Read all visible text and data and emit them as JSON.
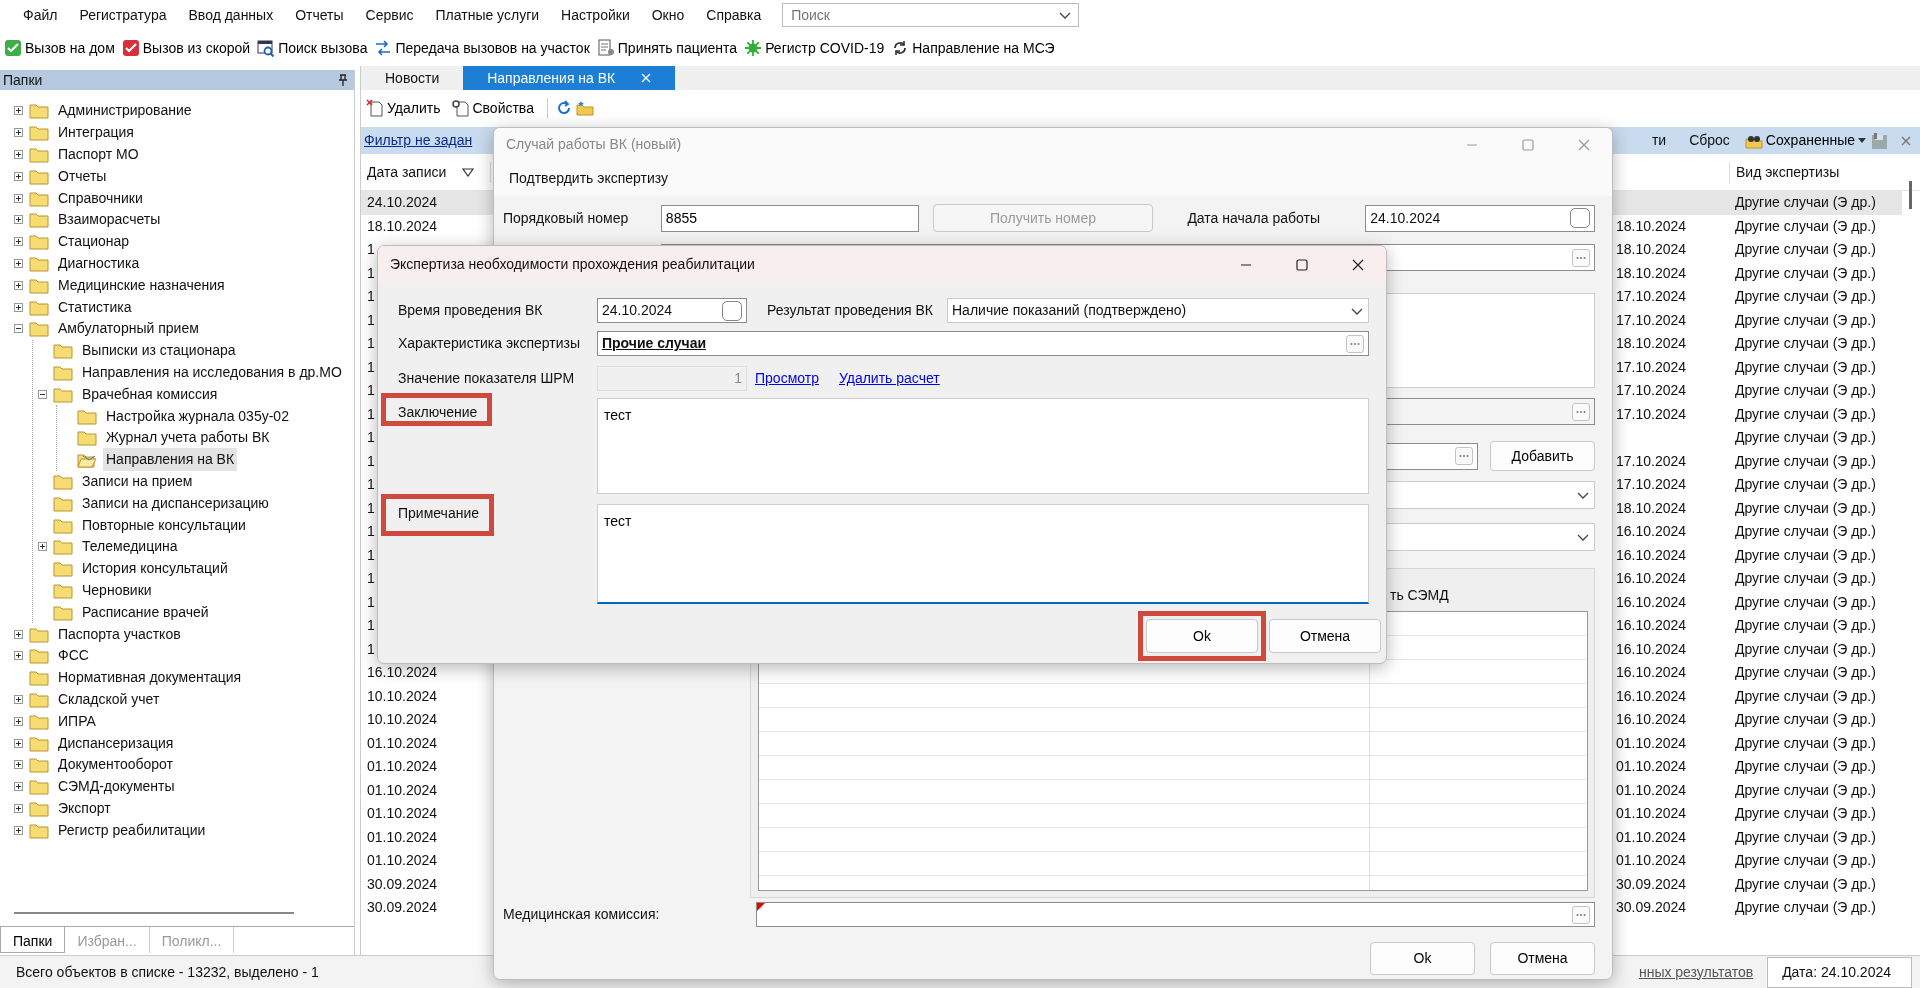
{
  "menu": [
    "Файл",
    "Регистратура",
    "Ввод данных",
    "Отчеты",
    "Сервис",
    "Платные услуги",
    "Настройки",
    "Окно",
    "Справка"
  ],
  "search": {
    "placeholder": "Поиск"
  },
  "toolbar": [
    "Вызов на дом",
    "Вызов из скорой",
    "Поиск вызова",
    "Передача вызовов на участок",
    "Принять пациента",
    "Регистр COVID-19",
    "Направление на МСЭ"
  ],
  "sidebar": {
    "title": "Папки",
    "tree": [
      {
        "label": "Администрирование",
        "expanded": false,
        "selected": false
      },
      {
        "label": "Интеграция",
        "expanded": false,
        "selected": false
      },
      {
        "label": "Паспорт МО",
        "expanded": false,
        "selected": false
      },
      {
        "label": "Отчеты",
        "expanded": false,
        "selected": false
      },
      {
        "label": "Справочники",
        "expanded": false,
        "selected": false
      },
      {
        "label": "Взаиморасчеты",
        "expanded": false,
        "selected": false
      },
      {
        "label": "Стационар",
        "expanded": false,
        "selected": false
      },
      {
        "label": "Диагностика",
        "expanded": false,
        "selected": false
      },
      {
        "label": "Медицинские назначения",
        "expanded": false,
        "selected": false
      },
      {
        "label": "Статистика",
        "expanded": false,
        "selected": false
      },
      {
        "label": "Амбулаторный прием",
        "expanded": true,
        "selected": false,
        "children": [
          {
            "label": "Выписки из стационара",
            "selected": false
          },
          {
            "label": "Направления на исследования в др.МО",
            "selected": false
          },
          {
            "label": "Врачебная комиссия",
            "expanded": true,
            "selected": false,
            "children": [
              {
                "label": "Настройка журнала 035у-02",
                "selected": false
              },
              {
                "label": "Журнал учета работы ВК",
                "selected": false
              },
              {
                "label": "Направления на ВК",
                "selected": true
              }
            ]
          },
          {
            "label": "Записи на прием",
            "selected": false
          },
          {
            "label": "Записи на диспансеризацию",
            "selected": false
          },
          {
            "label": "Повторные консультации",
            "selected": false
          },
          {
            "label": "Телемедицина",
            "expanded": false,
            "selected": false
          },
          {
            "label": "История консультаций",
            "selected": false
          },
          {
            "label": "Черновики",
            "selected": false
          },
          {
            "label": "Расписание врачей",
            "selected": false
          }
        ]
      },
      {
        "label": "Паспорта участков",
        "expanded": false,
        "selected": false
      },
      {
        "label": "ФСС",
        "expanded": false,
        "selected": false
      },
      {
        "label": "Нормативная документация",
        "selected": false
      },
      {
        "label": "Складской учет",
        "expanded": false,
        "selected": false
      },
      {
        "label": "ИПРА",
        "expanded": false,
        "selected": false
      },
      {
        "label": "Диспансеризация",
        "expanded": false,
        "selected": false
      },
      {
        "label": "Документооборот",
        "expanded": false,
        "selected": false
      },
      {
        "label": "СЭМД-документы",
        "expanded": false,
        "selected": false
      },
      {
        "label": "Экспорт",
        "expanded": false,
        "selected": false
      },
      {
        "label": "Регистр реабилитации",
        "expanded": false,
        "selected": false
      }
    ],
    "tabs": [
      {
        "label": "Папки",
        "selected": true
      },
      {
        "label": "Избран...",
        "selected": false
      },
      {
        "label": "Поликл...",
        "selected": false
      }
    ]
  },
  "tabs": [
    {
      "label": "Новости",
      "selected": false
    },
    {
      "label": "Направления на ВК",
      "selected": true
    }
  ],
  "list_toolbar": [
    "Удалить",
    "Свойства"
  ],
  "filter_bar": {
    "filter": "Фильтр не задан",
    "find_partial": "ти",
    "reset": "Сброс",
    "saved": "Сохраненные"
  },
  "grid": {
    "columns": [
      "Дата записи",
      "Вид экспертизы"
    ],
    "rows": [
      {
        "date": "24.10.2024",
        "type": "Другие случаи (Э др.)",
        "selected": true
      },
      {
        "date": "18.10.2024",
        "column_2": "18.10.2024",
        "type": "Другие случаи (Э др.)",
        "selected": false
      },
      {
        "date": "1",
        "column_2": "18.10.2024",
        "type": "Другие случаи (Э др.)",
        "selected": false
      },
      {
        "date": "1",
        "column_2": "18.10.2024",
        "type": "Другие случаи (Э др.)",
        "selected": false
      },
      {
        "date": "1",
        "column_2": "17.10.2024",
        "type": "Другие случаи (Э др.)",
        "selected": false
      },
      {
        "date": "1",
        "column_2": "17.10.2024",
        "type": "Другие случаи (Э др.)",
        "selected": false
      },
      {
        "date": "1",
        "column_2": "18.10.2024",
        "type": "Другие случаи (Э др.)",
        "selected": false
      },
      {
        "date": "1",
        "column_2": "17.10.2024",
        "type": "Другие случаи (Э др.)",
        "selected": false
      },
      {
        "date": "1",
        "column_2": "17.10.2024",
        "type": "Другие случаи (Э др.)",
        "selected": false
      },
      {
        "date": "1",
        "column_2": "17.10.2024",
        "type": "Другие случаи (Э др.)",
        "selected": false
      },
      {
        "date": "1",
        "type": "Другие случаи (Э др.)",
        "selected": false
      },
      {
        "date": "1",
        "column_2": "17.10.2024",
        "type": "Другие случаи (Э др.)",
        "selected": false
      },
      {
        "date": "1",
        "column_2": "17.10.2024",
        "type": "Другие случаи (Э др.)",
        "selected": false
      },
      {
        "date": "1",
        "column_2": "18.10.2024",
        "type": "Другие случаи (Э др.)",
        "selected": false
      },
      {
        "date": "1",
        "column_2": "16.10.2024",
        "type": "Другие случаи (Э др.)",
        "selected": false
      },
      {
        "date": "1",
        "column_2": "16.10.2024",
        "type": "Другие случаи (Э др.)",
        "selected": false
      },
      {
        "date": "1",
        "column_2": "16.10.2024",
        "type": "Другие случаи (Э др.)",
        "selected": false
      },
      {
        "date": "1",
        "column_2": "16.10.2024",
        "type": "Другие случаи (Э др.)",
        "selected": false
      },
      {
        "date": "1",
        "column_2": "16.10.2024",
        "type": "Другие случаи (Э др.)",
        "selected": false
      },
      {
        "date": "1",
        "column_2": "16.10.2024",
        "type": "Другие случаи (Э др.)",
        "selected": false
      },
      {
        "date": "16.10.2024",
        "column_2": "16.10.2024",
        "type": "Другие случаи (Э др.)",
        "selected": false
      },
      {
        "date": "10.10.2024",
        "column_2": "16.10.2024",
        "type": "Другие случаи (Э др.)",
        "selected": false
      },
      {
        "date": "10.10.2024",
        "column_2": "16.10.2024",
        "type": "Другие случаи (Э др.)",
        "selected": false
      },
      {
        "date": "01.10.2024",
        "column_2": "01.10.2024",
        "type": "Другие случаи (Э др.)",
        "selected": false
      },
      {
        "date": "01.10.2024",
        "column_2": "01.10.2024",
        "type": "Другие случаи (Э др.)",
        "selected": false
      },
      {
        "date": "01.10.2024",
        "column_2": "01.10.2024",
        "type": "Другие случаи (Э др.)",
        "selected": false
      },
      {
        "date": "01.10.2024",
        "column_2": "01.10.2024",
        "type": "Другие случаи (Э др.)",
        "selected": false
      },
      {
        "date": "01.10.2024",
        "column_2": "01.10.2024",
        "type": "Другие случаи (Э др.)",
        "selected": false
      },
      {
        "date": "01.10.2024",
        "column_2": "01.10.2024",
        "type": "Другие случаи (Э др.)",
        "selected": false
      },
      {
        "date": "30.09.2024",
        "column_2": "30.09.2024",
        "type": "Другие случаи (Э др.)",
        "selected": false
      },
      {
        "date": "30.09.2024",
        "column_2": "30.09.2024",
        "type": "Другие случаи (Э др.)",
        "selected": false
      }
    ]
  },
  "status_bar": {
    "count": "Всего объектов в списке - 13232, выделено - 1",
    "link": "нных результатов",
    "date": "Дата: 24.10.2024"
  },
  "case_window": {
    "title": "Случай работы ВК (новый)",
    "menu": "Подтвердить экспертизу",
    "number_label": "Порядковый номер",
    "number": "8855",
    "get_number": {
      "label": "Получить номер",
      "disabled": true
    },
    "start_label": "Дата начала работы",
    "start_date": "24.10.2024",
    "add_button": "Добавить",
    "grid_header": "ть СЭМД",
    "commission_label": "Медицинская комиссия:",
    "buttons": [
      "Ok",
      "Отмена"
    ]
  },
  "expertise_dialog": {
    "title": "Экспертиза необходимости прохождения реабилитации",
    "vk_time_label": "Время проведения ВК",
    "vk_time": "24.10.2024",
    "result_label": "Результат проведения ВК",
    "result": "Наличие показаний (подтверждено)",
    "characteristic_label": "Характеристика экспертизы",
    "characteristic": "Прочие случаи",
    "shrm_label": "Значение показателя ШРМ",
    "shrm_value": "1",
    "links": [
      "Просмотр",
      "Удалить расчет"
    ],
    "conclusion": {
      "label": "Заключение",
      "value": "тест",
      "highlighted": true,
      "focused": false
    },
    "note": {
      "label": "Примечание",
      "value": "тест",
      "highlighted": true,
      "focused": true
    },
    "buttons": [
      {
        "label": "Ok",
        "highlighted": true
      },
      {
        "label": "Отмена",
        "highlighted": false
      }
    ]
  }
}
